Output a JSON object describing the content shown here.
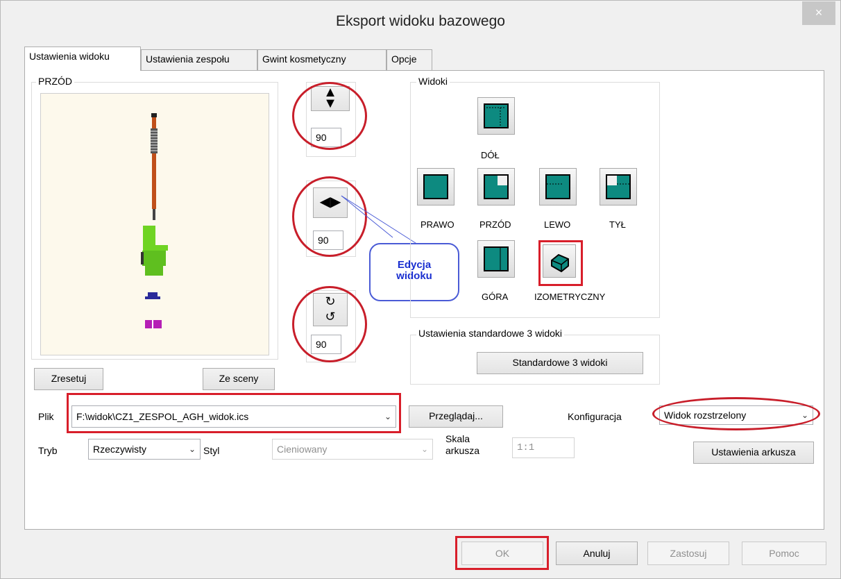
{
  "window": {
    "title": "Eksport widoku bazowego",
    "close_glyph": "×"
  },
  "tabs": [
    {
      "label": "Ustawienia widoku",
      "active": true
    },
    {
      "label": "Ustawienia zespołu",
      "active": false
    },
    {
      "label": "Gwint kosmetyczny",
      "active": false
    },
    {
      "label": "Opcje",
      "active": false
    }
  ],
  "preview": {
    "label": "PRZÓD"
  },
  "rotation": {
    "vertical_value": "90",
    "horizontal_value": "90",
    "roll_value": "90"
  },
  "preview_buttons": {
    "reset": "Zresetuj",
    "from_scene": "Ze sceny"
  },
  "views": {
    "label": "Widoki",
    "items": [
      {
        "label": "DÓŁ"
      },
      {
        "label": "PRAWO"
      },
      {
        "label": "PRZÓD"
      },
      {
        "label": "LEWO"
      },
      {
        "label": "TYŁ"
      },
      {
        "label": "GÓRA"
      },
      {
        "label": "IZOMETRYCZNY"
      }
    ]
  },
  "callout": {
    "line1": "Edycja",
    "line2": "widoku"
  },
  "standard": {
    "label": "Ustawienia standardowe 3 widoki",
    "button": "Standardowe 3 widoki"
  },
  "file": {
    "label": "Plik",
    "value": "F:\\widok\\CZ1_ZESPOL_AGH_widok.ics",
    "browse": "Przeglądaj..."
  },
  "config": {
    "label": "Konfiguracja",
    "value": "Widok rozstrzelony"
  },
  "mode": {
    "label": "Tryb",
    "value": "Rzeczywisty"
  },
  "style": {
    "label": "Styl",
    "value": "Cieniowany"
  },
  "scale": {
    "label_line1": "Skala",
    "label_line2": "arkusza",
    "value": "1:1"
  },
  "sheet_settings": "Ustawienia arkusza",
  "footer": {
    "ok": "OK",
    "cancel": "Anuluj",
    "apply": "Zastosuj",
    "help": "Pomoc"
  },
  "colors": {
    "teal": "#0d8a80",
    "highlight_red": "#d81e2a",
    "callout_blue": "#1a2fd0"
  }
}
